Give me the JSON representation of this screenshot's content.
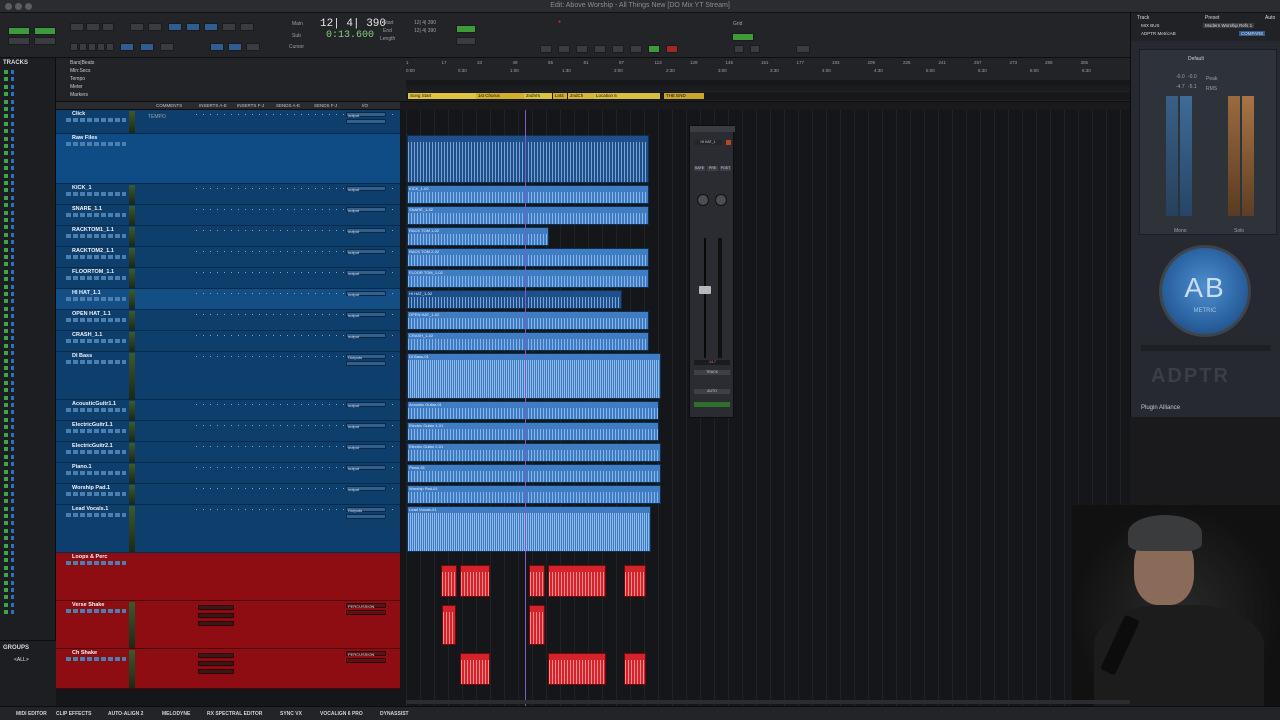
{
  "window": {
    "title": "Edit: Above Worship - All Things New [DO Mix YT Stream]"
  },
  "transport": {
    "main_counter": "12| 4| 390",
    "sub_counter": "0:13.600",
    "labels": [
      "Main",
      "Sub",
      "Cursor",
      "Start",
      "End",
      "Length",
      "Grid",
      "Nudge"
    ],
    "counter_readout": "12| 4| 390"
  },
  "tracks_panel": {
    "header": "TRACKS",
    "groups_header": "GROUPS",
    "groups_item": "<ALL>"
  },
  "rulers": {
    "names": [
      "Bars|Beats",
      "Min:Secs",
      "Tempo",
      "Meter",
      "Markers"
    ],
    "bar_ticks": [
      "1",
      "17",
      "33",
      "49",
      "65",
      "81",
      "97",
      "113",
      "129",
      "145",
      "161",
      "177",
      "193",
      "209",
      "225",
      "241",
      "257",
      "273",
      "289",
      "305"
    ],
    "time_ticks": [
      "0:00",
      "0:30",
      "1:00",
      "1:30",
      "2:00",
      "2:30",
      "3:00",
      "3:30",
      "4:00",
      "4:30",
      "5:00",
      "5:30",
      "6:00",
      "6:30"
    ],
    "markers": [
      {
        "label": "Song Start",
        "color": "#e0c341"
      },
      {
        "label": "1st Chorus",
        "color": "#d2b02c"
      },
      {
        "label": "2ndVrs",
        "color": "#d7c344"
      },
      {
        "label": "Lnt4",
        "color": "#cfae2c"
      },
      {
        "label": "2ndCh",
        "color": "#d7b63c"
      },
      {
        "label": "Location 6",
        "color": "#d7c040"
      },
      {
        "label": "THE END",
        "color": "#c9a52c"
      }
    ]
  },
  "columns": [
    "COMMENTS",
    "INSERTS A-E",
    "INSERTS F-J",
    "SENDS A-E",
    "SENDS F-J",
    "I/O"
  ],
  "tempo_label": "TEMPO",
  "tracks": [
    {
      "name": "Click",
      "kind": "blue",
      "io": "output"
    },
    {
      "name": "Raw Files",
      "kind": "folder",
      "io": ""
    },
    {
      "name": "KICK_1",
      "kind": "blue",
      "io": "output",
      "clip": "KICK_1-02"
    },
    {
      "name": "SNARE_1.1",
      "kind": "blue",
      "io": "output",
      "clip": "SNARE_1-02"
    },
    {
      "name": "RACKTOM1_1.1",
      "kind": "blue",
      "io": "output",
      "clip": "RACK TOM 1-02"
    },
    {
      "name": "RACKTOM2_1.1",
      "kind": "blue",
      "io": "output",
      "clip": "RACK TOM 2-02"
    },
    {
      "name": "FLOORTOM_1.1",
      "kind": "blue",
      "io": "output",
      "clip": "FLOOR TOM_1-02"
    },
    {
      "name": "HI HAT_1.1",
      "kind": "blue",
      "io": "output",
      "clip": "HI HAT_1-02"
    },
    {
      "name": "OPEN HAT_1.1",
      "kind": "blue",
      "io": "output",
      "clip": "OPEN HAT_1-02"
    },
    {
      "name": "CRASH_1.1",
      "kind": "blue",
      "io": "output",
      "clip": "CRASH_1-02"
    },
    {
      "name": "DI Bass",
      "kind": "blue",
      "io": "Outputs",
      "clip": "DI Bass-01"
    },
    {
      "name": "AcousticGuitr1.1",
      "kind": "blue",
      "io": "output",
      "clip": "Acoustic Guitar-01"
    },
    {
      "name": "ElectricGuitr1.1",
      "kind": "blue",
      "io": "output",
      "clip": "Electric Guitar 1-01"
    },
    {
      "name": "ElectricGuitr2.1",
      "kind": "blue",
      "io": "output",
      "clip": "Electric Guitar 2-01"
    },
    {
      "name": "Piano.1",
      "kind": "blue",
      "io": "output",
      "clip": "Piano-01"
    },
    {
      "name": "Worship Pad.1",
      "kind": "blue",
      "io": "output",
      "clip": "Worship Pad-01"
    },
    {
      "name": "Lead Vocals.1",
      "kind": "blue",
      "io": "Outputs",
      "clip": "Lead Vocals-01"
    },
    {
      "name": "Loops & Perc",
      "kind": "red",
      "io": ""
    },
    {
      "name": "Verse Shake",
      "kind": "red",
      "io": "PERCUSSION"
    },
    {
      "name": "Ch Shake",
      "kind": "red",
      "io": "PERCUSSION"
    }
  ],
  "mixer_strip": {
    "name": "HI HAT_1",
    "buttons": [
      "SAFE",
      "PRE",
      "POST"
    ],
    "track_label": "TRACK",
    "auto_label": "AUTO",
    "readout": "-14.7"
  },
  "plugin": {
    "track_label": "Track",
    "preset_label": "Preset",
    "auto_label": "Auto",
    "track_name": "MIX BUS",
    "plugin_name": "ADPTR MetricAB",
    "preset_name": "Modern Worship Refs 1",
    "compare_label": "COMPARE",
    "default_label": "Default",
    "mono_label": "Mono",
    "solo_label": "Solo",
    "ab_text": "AB",
    "metric_text": "METRIC",
    "brand_text": "ADPTR",
    "footer": "Plugin Alliance",
    "values": [
      "-0.0",
      "-0.0",
      "-4.7",
      "-5.1"
    ],
    "meter_labels": [
      "Peak",
      "RMS"
    ]
  },
  "bottom_bar": [
    "MIDI EDITOR",
    "CLIP EFFECTS",
    "AUTO-ALIGN 2",
    "MELODYNE",
    "RX SPECTRAL EDITOR",
    "SYNC VX",
    "VOCALIGN 6 PRO",
    "DYNASSIST"
  ],
  "colors": {
    "track_blue": "#0e3e6c",
    "track_red": "#8e0d12",
    "clip_blue": "#3f7cc2",
    "clip_red": "#d4232a",
    "marker_yellow": "#e0c341",
    "playhead": "#7e5ac9"
  }
}
